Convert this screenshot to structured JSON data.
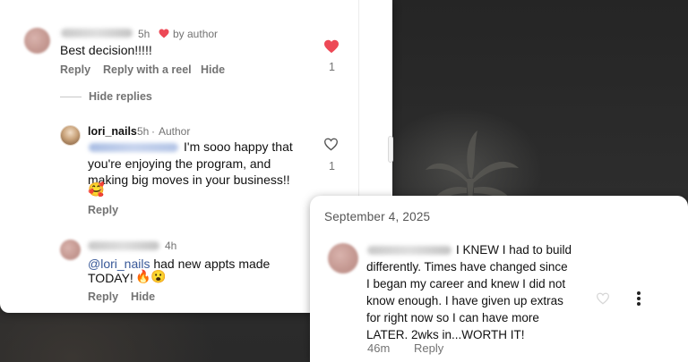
{
  "comment1": {
    "time": "5h",
    "author_like_label": "by author",
    "text": "Best decision!!!!!",
    "actions": {
      "reply": "Reply",
      "reply_with_reel": "Reply with a reel",
      "hide": "Hide"
    },
    "like_count": "1",
    "hide_replies": "Hide replies"
  },
  "reply1": {
    "username": "lori_nails",
    "time": "5h",
    "badge": "Author",
    "lines": [
      "I'm sooo happy that",
      "you're enjoying the program, and",
      "making big moves in your business!!"
    ],
    "emoji": "🥰",
    "reply_label": "Reply",
    "like_count": "1"
  },
  "reply2": {
    "time": "4h",
    "mention": "@lori_nails",
    "text_after_mention": " had new appts made",
    "line2": "TODAY!",
    "emojis": "🔥😮",
    "actions": {
      "reply": "Reply",
      "hide": "Hide"
    }
  },
  "right_panel": {
    "date": "September 4, 2025",
    "lines": [
      "I KNEW I had to build",
      "differently. Times have changed since",
      "I began my career and knew I did not",
      "know enough.  I have given up extras",
      "for right now so I can have more",
      "LATER.  2wks in...WORTH IT!"
    ],
    "time": "46m",
    "reply_label": "Reply"
  },
  "colors": {
    "heart": "#ed4956",
    "mention": "#385898",
    "muted": "#737373"
  }
}
